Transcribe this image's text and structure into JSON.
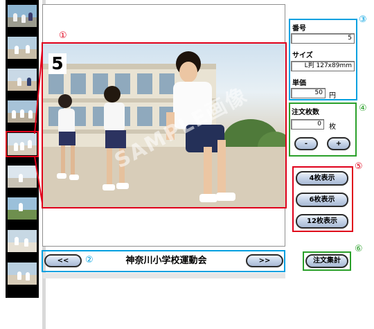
{
  "photo": {
    "number": "5",
    "watermark": "SAMPLE画像"
  },
  "markers": {
    "photo": "①",
    "nav": "②",
    "info": "③",
    "quantity": "④",
    "view": "⑤",
    "order": "⑥"
  },
  "info": {
    "number_label": "番号",
    "number_value": "5",
    "size_label": "サイズ",
    "size_value": "L判 127x89mm",
    "price_label": "単価",
    "price_value": "50",
    "price_unit": "円"
  },
  "quantity": {
    "label": "注文枚数",
    "value": "0",
    "unit": "枚",
    "minus_label": "-",
    "plus_label": "+"
  },
  "view": {
    "btn4": "4枚表示",
    "btn6": "6枚表示",
    "btn12": "12枚表示"
  },
  "nav": {
    "prev": "<<",
    "next": ">>",
    "title": "神奈川小学校運動会"
  },
  "order": {
    "label": "注文集計"
  },
  "colors": {
    "red": "#e0001b",
    "blue": "#00a0e0",
    "green": "#2aa02a"
  }
}
